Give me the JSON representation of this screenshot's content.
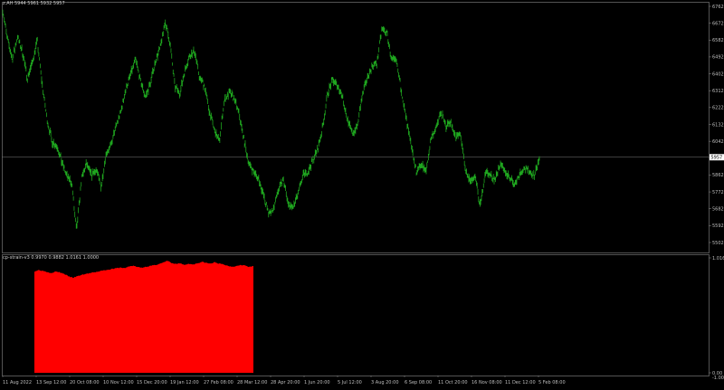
{
  "main_pane": {
    "header": "z.AH  5944  5961  5932  5957",
    "current_price_label": "5957",
    "bar_color": "#1fa61f",
    "price_line_color": "#7a7a7a"
  },
  "indicator_pane": {
    "header": "cp-strain-v3  0.9970  0.9882  1.0161  1.0000",
    "fill_color": "#ff0000"
  },
  "x_labels": [
    "11 Aug 2022",
    "13 Sep 12:00",
    "20 Oct 08:00",
    "10 Nov 12:00",
    "15 Dec 20:00",
    "19 Jan 12:00",
    "27 Feb 08:00",
    "28 Mar 12:00",
    "28 Apr 20:00",
    "1 Jun 20:00",
    "5 Jul 12:00",
    "3 Aug 20:00",
    "6 Sep 08:00",
    "11 Oct 20:00",
    "16 Nov 08:00",
    "11 Dec 12:00",
    "5 Feb 08:00"
  ],
  "chart_data": [
    {
      "type": "line",
      "ylim": [
        5502,
        6762
      ],
      "yticks": [
        6762,
        6672,
        6582,
        6492,
        6402,
        6312,
        6222,
        6132,
        6042,
        5952,
        5862,
        5772,
        5682,
        5592,
        5502
      ],
      "last_price": 5957,
      "series": [
        {
          "values": [
            6740,
            6580,
            6480,
            6600,
            6520,
            6380,
            6460,
            6580,
            6350,
            6160,
            6040,
            6020,
            5930,
            5860,
            5820,
            5560,
            5840,
            5920,
            5860,
            5890,
            5800,
            5980,
            6020,
            6120,
            6200,
            6320,
            6400,
            6480,
            6360,
            6280,
            6350,
            6470,
            6540,
            6680,
            6560,
            6330,
            6300,
            6420,
            6500,
            6520,
            6380,
            6340,
            6200,
            6100,
            6040,
            6260,
            6300,
            6270,
            6190,
            6050,
            5920,
            5880,
            5840,
            5750,
            5660,
            5680,
            5780,
            5840,
            5700,
            5690,
            5760,
            5860,
            5880,
            5940,
            6000,
            6120,
            6300,
            6370,
            6340,
            6280,
            6160,
            6080,
            6120,
            6280,
            6380,
            6440,
            6460,
            6640,
            6620,
            6480,
            6460,
            6310,
            6150,
            6010,
            5880,
            5920,
            5880,
            6060,
            6110,
            6200,
            6120,
            6150,
            6060,
            6080,
            5880,
            5830,
            5850,
            5690,
            5880,
            5860,
            5840,
            5920,
            5880,
            5850,
            5810,
            5870,
            5900,
            5880,
            5860,
            5950
          ]
        }
      ]
    },
    {
      "type": "area",
      "ylim": [
        0,
        1.0161
      ],
      "yticks": [
        1.0161,
        0.0
      ],
      "y_tick_labels": [
        "1.0161",
        "0.00"
      ],
      "series": [
        {
          "values": [
            0.918,
            0.931,
            0.924,
            0.913,
            0.905,
            0.917,
            0.909,
            0.895,
            0.872,
            0.861,
            0.874,
            0.887,
            0.896,
            0.903,
            0.909,
            0.918,
            0.927,
            0.933,
            0.941,
            0.946,
            0.953,
            0.948,
            0.962,
            0.971,
            0.957,
            0.952,
            0.961,
            0.968,
            0.974,
            0.986,
            0.997,
            1.016,
            0.992,
            0.984,
            0.991,
            0.978,
            0.987,
            0.982,
            0.993,
            1.004,
            0.996,
            0.988,
            1.001,
            0.989,
            0.981,
            0.969,
            0.962,
            0.966,
            0.979,
            0.972,
            0.958,
            0.966
          ]
        }
      ]
    }
  ]
}
